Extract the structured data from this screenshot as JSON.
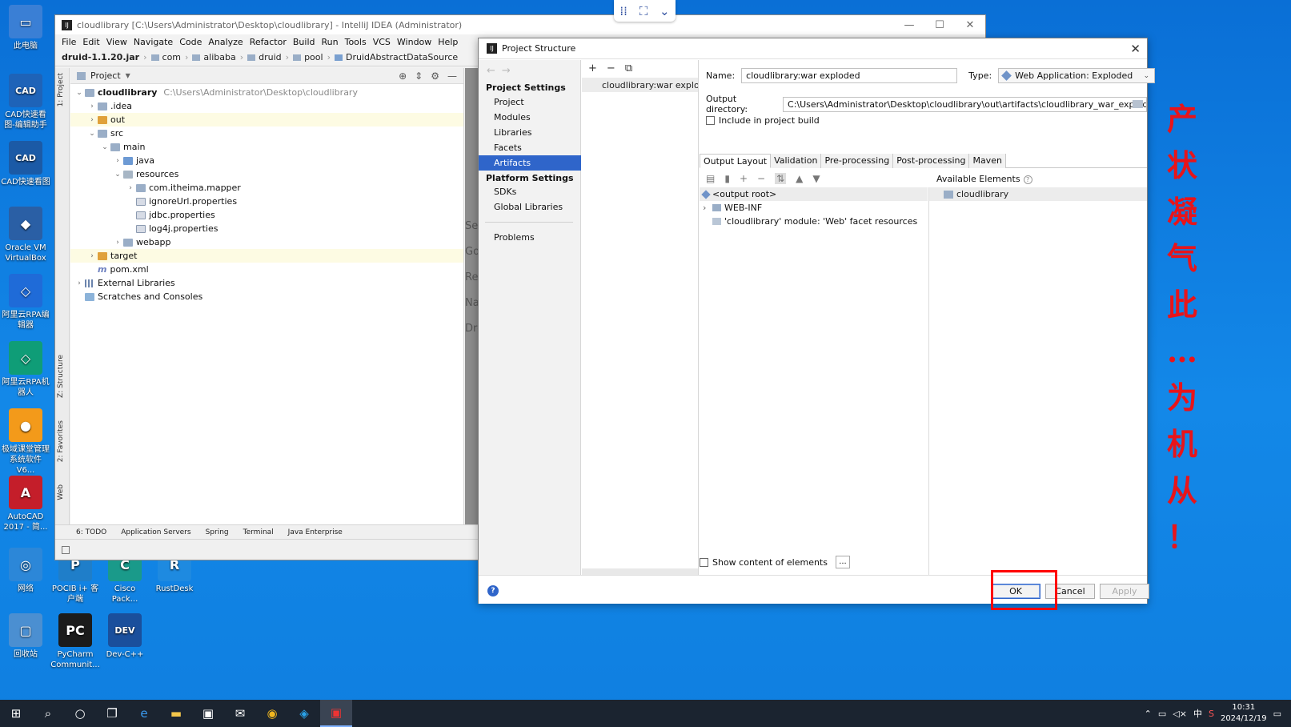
{
  "desktop": {
    "icons": [
      {
        "label": "此电脑",
        "color": "#3a7fd5",
        "glyph": "▭"
      },
      {
        "label": "CAD快速看图-编辑助手",
        "color": "#1e63b8",
        "glyph": "CAD"
      },
      {
        "label": "CAD快速看图",
        "color": "#1b5aa6",
        "glyph": "CAD"
      },
      {
        "label": "Oracle VM VirtualBox",
        "color": "#2a5fa5",
        "glyph": "◆"
      },
      {
        "label": "阿里云RPA编辑器",
        "color": "#1f6bd8",
        "glyph": "◇"
      },
      {
        "label": "阿里云RPA机器人",
        "color": "#0f9d77",
        "glyph": "◇"
      },
      {
        "label": "极域课堂管理系统软件V6...",
        "color": "#f39a1a",
        "glyph": "●"
      },
      {
        "label": "AutoCAD 2017 - 简...",
        "color": "#c41e2a",
        "glyph": "A"
      },
      {
        "label": "网络",
        "color": "#2c87d8",
        "glyph": "◎"
      },
      {
        "label": "回收站",
        "color": "#4b8fd1",
        "glyph": "▢"
      },
      {
        "label": "POCIB i+ 客户端",
        "color": "#1f7ec9",
        "glyph": "P"
      },
      {
        "label": "Cisco Pack...",
        "color": "#1a9a8a",
        "glyph": "C"
      },
      {
        "label": "RustDesk",
        "color": "#1e8ae0",
        "glyph": "R"
      },
      {
        "label": "PyCharm Communit...",
        "color": "#1b1b1b",
        "glyph": "PC"
      },
      {
        "label": "Dev-C++",
        "color": "#1a4f9c",
        "glyph": "DEV"
      }
    ],
    "red_text": [
      "产",
      "状",
      "凝",
      "气",
      "此",
      "…",
      "为",
      "机",
      "从",
      "！"
    ]
  },
  "ide": {
    "title": "cloudlibrary [C:\\Users\\Administrator\\Desktop\\cloudlibrary] - IntelliJ IDEA (Administrator)",
    "menu": [
      "File",
      "Edit",
      "View",
      "Navigate",
      "Code",
      "Analyze",
      "Refactor",
      "Build",
      "Run",
      "Tools",
      "VCS",
      "Window",
      "Help"
    ],
    "breadcrumb": [
      "druid-1.1.20.jar",
      "com",
      "alibaba",
      "druid",
      "pool",
      "DruidAbstractDataSource"
    ],
    "left_tabs": [
      "1: Project",
      "Z: Structure",
      "2: Favorites",
      "Web"
    ],
    "project_header": "Project",
    "tree": [
      {
        "label": "cloudlibrary",
        "path": "C:\\Users\\Administrator\\Desktop\\cloudlibrary",
        "indent": 0,
        "arrow": "⌄",
        "icon": "f-folder",
        "bold": true
      },
      {
        "label": ".idea",
        "indent": 1,
        "arrow": "›",
        "icon": "f-folder"
      },
      {
        "label": "out",
        "indent": 1,
        "arrow": "›",
        "icon": "f-orange",
        "hl": true
      },
      {
        "label": "src",
        "indent": 1,
        "arrow": "⌄",
        "icon": "f-folder"
      },
      {
        "label": "main",
        "indent": 2,
        "arrow": "⌄",
        "icon": "f-folder"
      },
      {
        "label": "java",
        "indent": 3,
        "arrow": "›",
        "icon": "f-blue"
      },
      {
        "label": "resources",
        "indent": 3,
        "arrow": "⌄",
        "icon": "f-res"
      },
      {
        "label": "com.itheima.mapper",
        "indent": 4,
        "arrow": "›",
        "icon": "f-folder"
      },
      {
        "label": "ignoreUrl.properties",
        "indent": 4,
        "arrow": "",
        "icon": "f-prop"
      },
      {
        "label": "jdbc.properties",
        "indent": 4,
        "arrow": "",
        "icon": "f-prop"
      },
      {
        "label": "log4j.properties",
        "indent": 4,
        "arrow": "",
        "icon": "f-prop"
      },
      {
        "label": "webapp",
        "indent": 3,
        "arrow": "›",
        "icon": "f-folder"
      },
      {
        "label": "target",
        "indent": 1,
        "arrow": "›",
        "icon": "f-orange",
        "hl": true
      },
      {
        "label": "pom.xml",
        "indent": 1,
        "arrow": "",
        "icon": "f-m"
      },
      {
        "label": "External Libraries",
        "indent": 0,
        "arrow": "›",
        "icon": "f-lib"
      },
      {
        "label": "Scratches and Consoles",
        "indent": 0,
        "arrow": "",
        "icon": "f-scr"
      }
    ],
    "editor_hints": [
      "Search E",
      "Go to Fi",
      "Recent F",
      "Navigati",
      "Drop file"
    ],
    "bottom_tabs": [
      "6: TODO",
      "Application Servers",
      "Spring",
      "Terminal",
      "Java Enterprise"
    ]
  },
  "dialog": {
    "title": "Project Structure",
    "project_settings_label": "Project Settings",
    "project_settings": [
      "Project",
      "Modules",
      "Libraries",
      "Facets",
      "Artifacts"
    ],
    "selected_item": "Artifacts",
    "platform_settings_label": "Platform Settings",
    "platform_settings": [
      "SDKs",
      "Global Libraries"
    ],
    "problems": "Problems",
    "artifact_item": "cloudlibrary:war exploded",
    "name_label": "Name:",
    "name_value": "cloudlibrary:war exploded",
    "type_label": "Type:",
    "type_value": "Web Application: Exploded",
    "output_dir_label": "Output directory:",
    "output_dir_value": "C:\\Users\\Administrator\\Desktop\\cloudlibrary\\out\\artifacts\\cloudlibrary_war_exploded",
    "include_label": "Include in project build",
    "tabs": [
      "Output Layout",
      "Validation",
      "Pre-processing",
      "Post-processing",
      "Maven"
    ],
    "layout_tree": [
      {
        "label": "<output root>",
        "indent": 0
      },
      {
        "label": "WEB-INF",
        "indent": 1
      },
      {
        "label": "'cloudlibrary' module: 'Web' facet resources",
        "indent": 1
      }
    ],
    "available_label": "Available Elements",
    "available_items": [
      "cloudlibrary"
    ],
    "show_content_label": "Show content of elements",
    "ok": "OK",
    "cancel": "Cancel",
    "apply": "Apply"
  },
  "taskbar": {
    "time": "10:31",
    "date": "2024/12/19",
    "ime": "中"
  }
}
